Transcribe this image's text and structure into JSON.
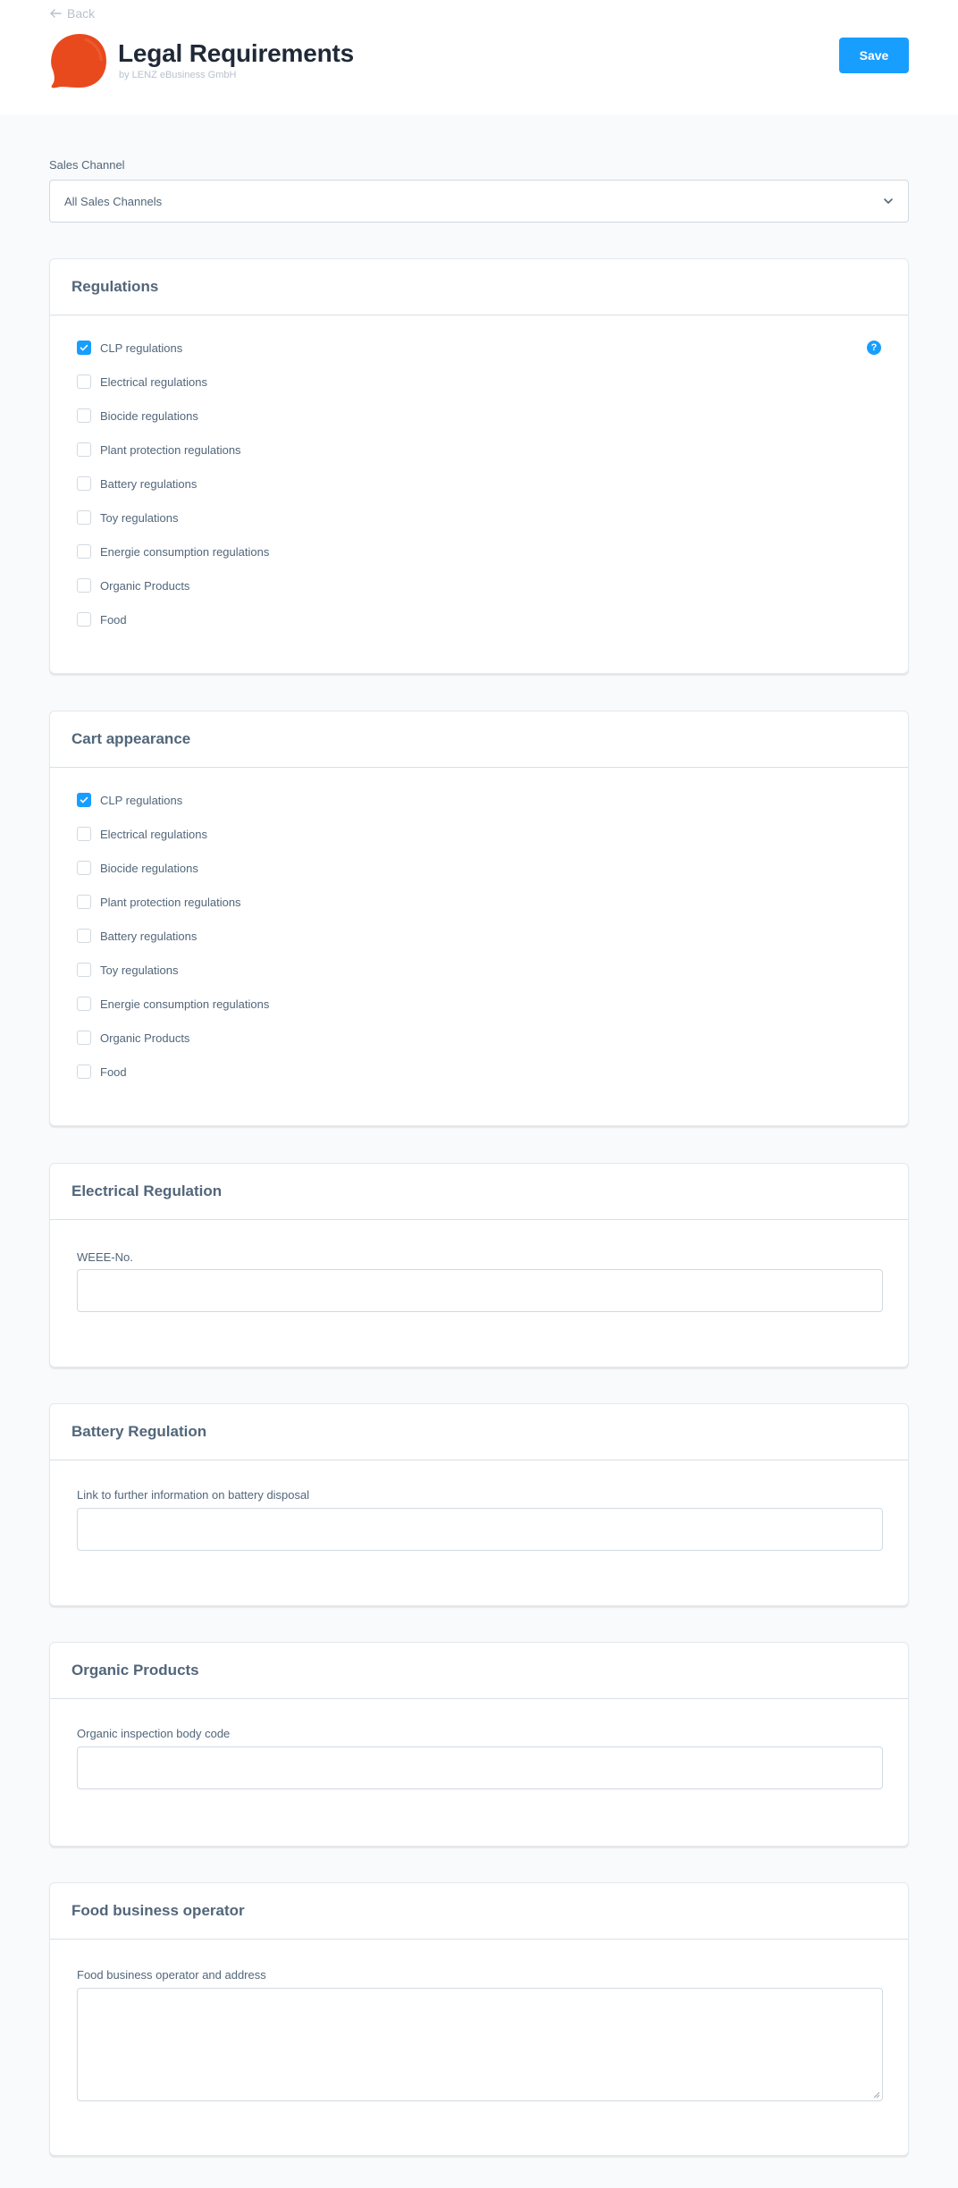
{
  "header": {
    "back_label": "Back",
    "title": "Legal Requirements",
    "subtitle": "by LENZ eBusiness GmbH",
    "save_label": "Save"
  },
  "sales_channel": {
    "label": "Sales Channel",
    "selected": "All Sales Channels"
  },
  "regulations": {
    "title": "Regulations",
    "items": [
      {
        "label": "CLP regulations",
        "checked": true
      },
      {
        "label": "Electrical regulations",
        "checked": false
      },
      {
        "label": "Biocide regulations",
        "checked": false
      },
      {
        "label": "Plant protection regulations",
        "checked": false
      },
      {
        "label": "Battery regulations",
        "checked": false
      },
      {
        "label": "Toy regulations",
        "checked": false
      },
      {
        "label": "Energie consumption regulations",
        "checked": false
      },
      {
        "label": "Organic Products",
        "checked": false
      },
      {
        "label": "Food",
        "checked": false
      }
    ]
  },
  "cart_appearance": {
    "title": "Cart appearance",
    "items": [
      {
        "label": "CLP regulations",
        "checked": true
      },
      {
        "label": "Electrical regulations",
        "checked": false
      },
      {
        "label": "Biocide regulations",
        "checked": false
      },
      {
        "label": "Plant protection regulations",
        "checked": false
      },
      {
        "label": "Battery regulations",
        "checked": false
      },
      {
        "label": "Toy regulations",
        "checked": false
      },
      {
        "label": "Energie consumption regulations",
        "checked": false
      },
      {
        "label": "Organic Products",
        "checked": false
      },
      {
        "label": "Food",
        "checked": false
      }
    ]
  },
  "electrical": {
    "title": "Electrical Regulation",
    "field_label": "WEEE-No.",
    "value": ""
  },
  "battery": {
    "title": "Battery Regulation",
    "field_label": "Link to further information on battery disposal",
    "value": ""
  },
  "organic": {
    "title": "Organic Products",
    "field_label": "Organic inspection body code",
    "value": ""
  },
  "food": {
    "title": "Food business operator",
    "field_label": "Food business operator and address",
    "value": ""
  },
  "colors": {
    "accent": "#189eff",
    "logo": "#e84a1e",
    "text": "#52667a",
    "background": "#f9fafb"
  },
  "icons": {
    "back": "arrow-left-icon",
    "logo": "speech-bubble-logo",
    "select": "chevron-down-icon",
    "help": "help-icon",
    "check": "check-icon"
  }
}
